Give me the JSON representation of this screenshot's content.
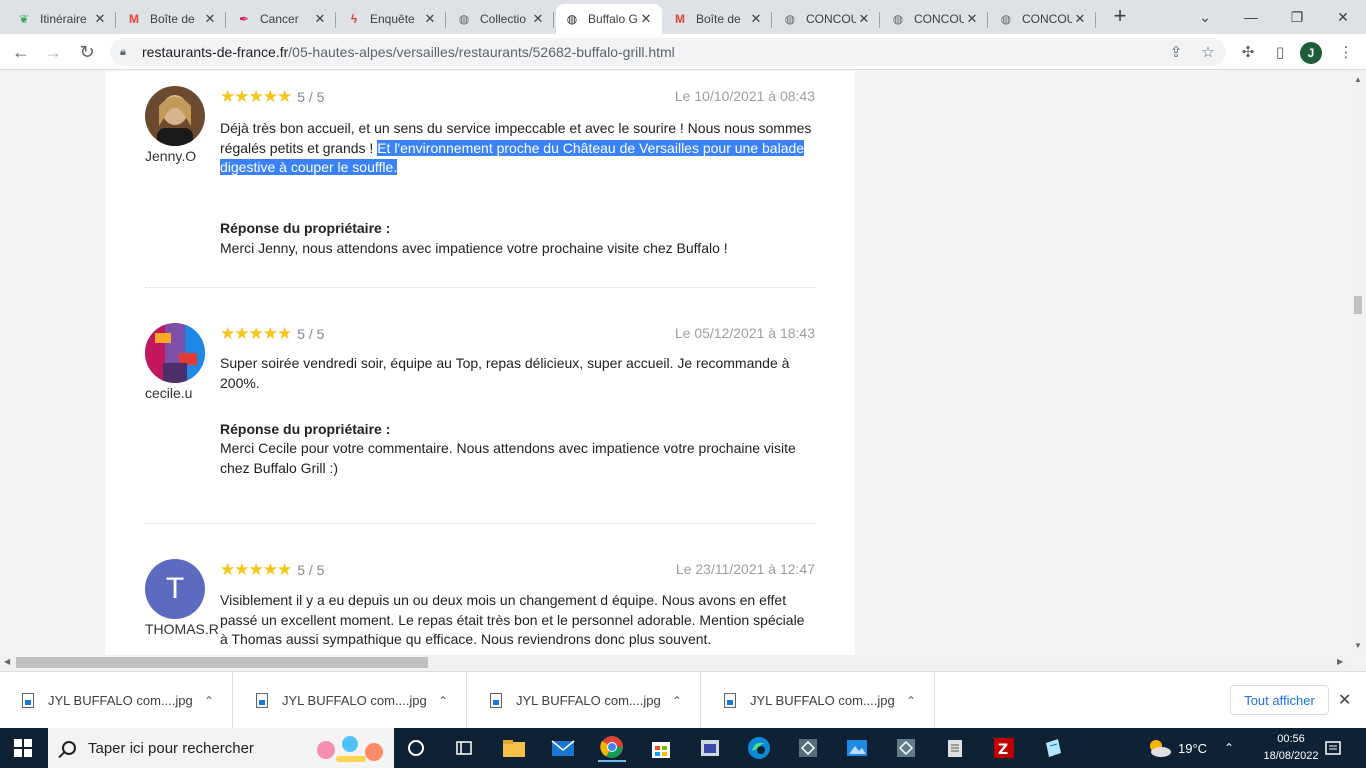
{
  "tabs": [
    {
      "title": "Itinéraire",
      "icon": "maps-icon",
      "color": "#34a853"
    },
    {
      "title": "Boîte de",
      "icon": "gmail-icon",
      "color": "#ea4335"
    },
    {
      "title": "Cancer",
      "icon": "pen-icon",
      "color": "#d81b60"
    },
    {
      "title": "Enquête",
      "icon": "lightning-icon",
      "color": "#e53935"
    },
    {
      "title": "Collectio",
      "icon": "globe-icon",
      "color": "#5f6368"
    },
    {
      "title": "Buffalo G",
      "icon": "globe-icon",
      "color": "#202124"
    },
    {
      "title": "Boîte de",
      "icon": "gmail-icon",
      "color": "#ea4335"
    },
    {
      "title": "CONCOU",
      "icon": "globe-icon",
      "color": "#5f6368"
    },
    {
      "title": "CONCOU",
      "icon": "globe-icon",
      "color": "#5f6368"
    },
    {
      "title": "CONCOU",
      "icon": "globe-icon",
      "color": "#5f6368"
    }
  ],
  "address": {
    "host": "restaurants-de-france.fr",
    "path": "/05-hautes-alpes/versailles/restaurants/52682-buffalo-grill.html"
  },
  "profile_initial": "J",
  "reviews": [
    {
      "user": "Jenny.O",
      "score": "5 / 5",
      "date": "Le 10/10/2021 à 08:43",
      "text": "Déjà très bon accueil, et un sens du service impeccable et avec le sourire ! Nous nous sommes régalés petits et grands ! ",
      "text_highlight": "Et l'environnement proche du Château de Versailles pour une balade digestive à couper le souffle.",
      "response_label": "Réponse du propriétaire :",
      "response": "Merci Jenny, nous attendons avec impatience votre prochaine visite chez Buffalo !"
    },
    {
      "user": "cecile.u",
      "score": "5 / 5",
      "date": "Le 05/12/2021 à 18:43",
      "text": "Super soirée vendredi soir, équipe au Top, repas délicieux, super accueil. Je recommande à 200%.",
      "response_label": "Réponse du propriétaire :",
      "response": "Merci Cecile pour votre commentaire. Nous attendons avec impatience votre prochaine visite chez Buffalo Grill :)"
    },
    {
      "user": "THOMAS.R",
      "avatar_letter": "T",
      "score": "5 / 5",
      "date": "Le 23/11/2021 à 12:47",
      "text": "Visiblement il y a eu depuis un ou deux mois un changement d équipe. Nous avons en effet passé un excellent moment. Le repas était très bon et le personnel adorable. Mention spéciale à Thomas aussi sympathique qu efficace. Nous reviendrons donc plus souvent."
    }
  ],
  "downloads": [
    {
      "name": "JYL   BUFFALO com....jpg"
    },
    {
      "name": "JYL   BUFFALO com....jpg"
    },
    {
      "name": "JYL   BUFFALO com....jpg"
    },
    {
      "name": "JYL   BUFFALO com....jpg"
    }
  ],
  "show_all_label": "Tout afficher",
  "taskbar": {
    "search_placeholder": "Taper ici pour rechercher",
    "temperature": "19°C",
    "time": "00:56",
    "date": "18/08/2022"
  },
  "colors": {
    "star": "#f5c518",
    "highlight": "#3b82f6",
    "avatar_t": "#5c6bc0",
    "taskbar": "#0f2235"
  }
}
